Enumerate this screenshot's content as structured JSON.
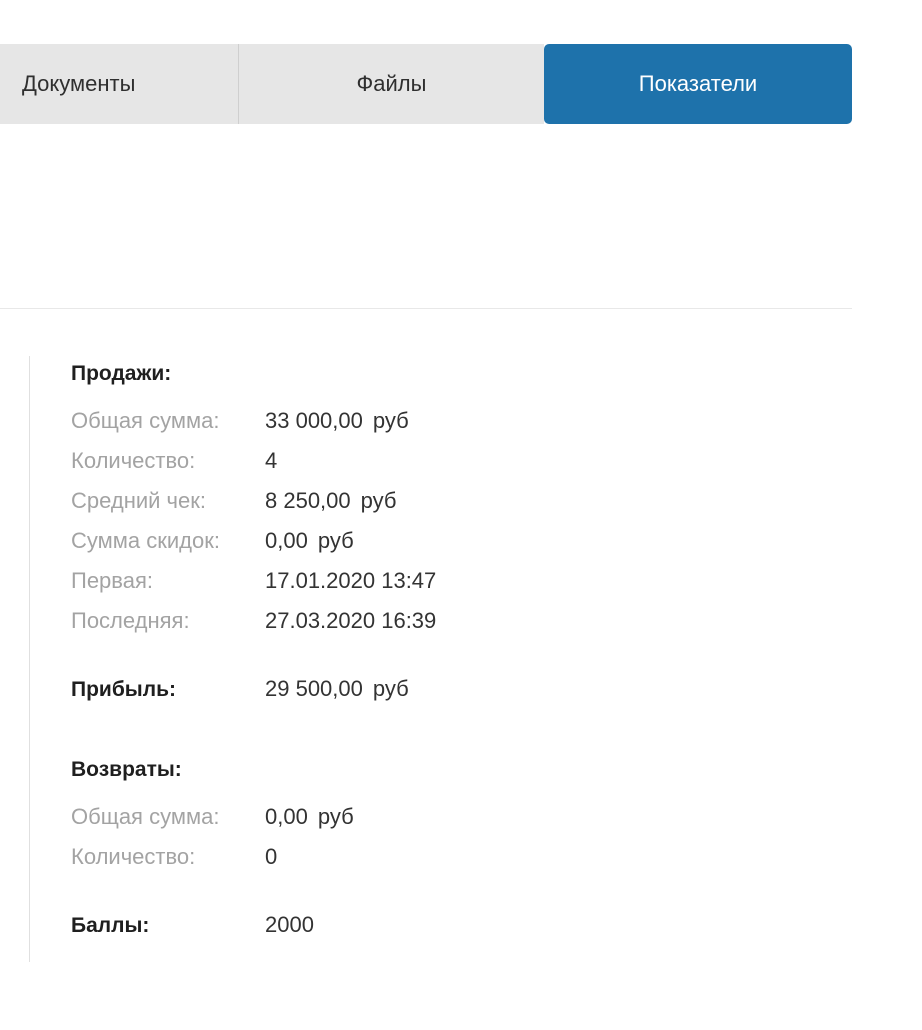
{
  "tabs": [
    {
      "label": "Документы"
    },
    {
      "label": "Файлы"
    },
    {
      "label": "Показатели",
      "active": true
    }
  ],
  "colors": {
    "active_tab_bg": "#1e72ab",
    "tab_bg": "#e6e6e6",
    "label_text": "#a3a3a3"
  },
  "sales": {
    "title": "Продажи:",
    "rows": [
      {
        "label": "Общая сумма:",
        "value": "33 000,00",
        "unit": "руб"
      },
      {
        "label": "Количество:",
        "value": "4"
      },
      {
        "label": "Средний чек:",
        "value": "8 250,00",
        "unit": "руб"
      },
      {
        "label": "Сумма скидок:",
        "value": "0,00",
        "unit": "руб"
      },
      {
        "label": "Первая:",
        "value": "17.01.2020 13:47"
      },
      {
        "label": "Последняя:",
        "value": "27.03.2020 16:39"
      }
    ]
  },
  "profit": {
    "title": "Прибыль:",
    "value": "29 500,00",
    "unit": "руб"
  },
  "returns": {
    "title": "Возвраты:",
    "rows": [
      {
        "label": "Общая сумма:",
        "value": "0,00",
        "unit": "руб"
      },
      {
        "label": "Количество:",
        "value": "0"
      }
    ]
  },
  "points": {
    "title": "Баллы:",
    "value": "2000"
  }
}
